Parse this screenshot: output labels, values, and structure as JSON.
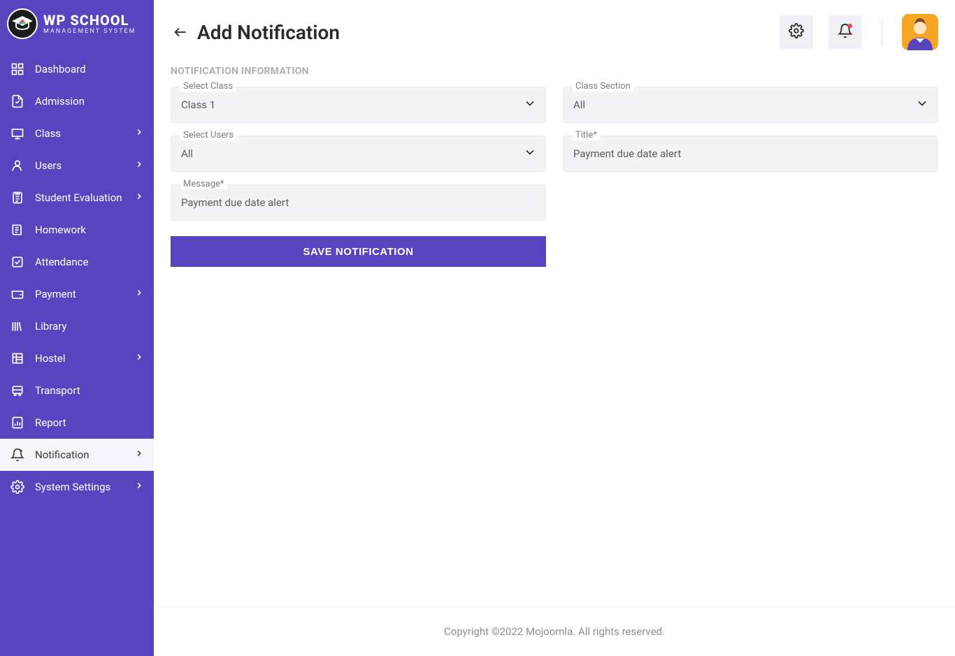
{
  "brand": {
    "title": "WP SCHOOL",
    "subtitle": "MANAGEMENT SYSTEM"
  },
  "sidebar": {
    "items": [
      {
        "label": "Dashboard",
        "expandable": false
      },
      {
        "label": "Admission",
        "expandable": false
      },
      {
        "label": "Class",
        "expandable": true
      },
      {
        "label": "Users",
        "expandable": true
      },
      {
        "label": "Student Evaluation",
        "expandable": true
      },
      {
        "label": "Homework",
        "expandable": false
      },
      {
        "label": "Attendance",
        "expandable": false
      },
      {
        "label": "Payment",
        "expandable": true
      },
      {
        "label": "Library",
        "expandable": false
      },
      {
        "label": "Hostel",
        "expandable": true
      },
      {
        "label": "Transport",
        "expandable": false
      },
      {
        "label": "Report",
        "expandable": false
      },
      {
        "label": "Notification",
        "expandable": true,
        "active": true
      },
      {
        "label": "System Settings",
        "expandable": true
      }
    ]
  },
  "page": {
    "title": "Add Notification",
    "section": "NOTIFICATION INFORMATION"
  },
  "form": {
    "select_class": {
      "label": "Select Class",
      "value": "Class 1"
    },
    "class_section": {
      "label": "Class Section",
      "value": "All"
    },
    "select_users": {
      "label": "Select Users",
      "value": "All"
    },
    "title_field": {
      "label": "Title*",
      "value": "Payment due date alert"
    },
    "message": {
      "label": "Message*",
      "value": "Payment due date alert"
    },
    "save_label": "SAVE NOTIFICATION"
  },
  "footer": {
    "text": "Copyright ©2022 Mojoomla. All rights reserved."
  }
}
